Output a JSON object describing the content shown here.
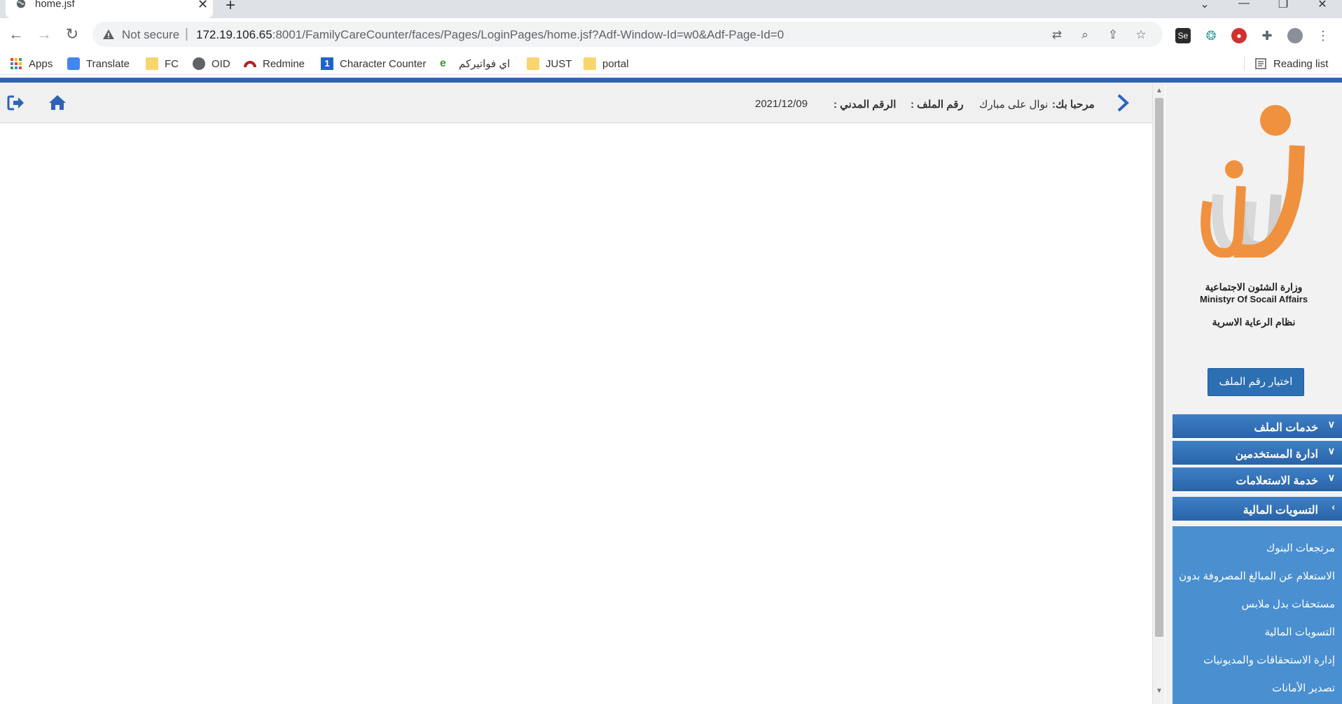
{
  "browser": {
    "tab_title": "home.jsf",
    "security_label": "Not secure",
    "url_host": "172.19.106.65",
    "url_path": ":8001/FamilyCareCounter/faces/Pages/LoginPages/home.jsf?Adf-Window-Id=w0&Adf-Page-Id=0",
    "ext_selenium_label": "Se",
    "bookmarks": {
      "apps": "Apps",
      "translate": "Translate",
      "fc": "FC",
      "oid": "OID",
      "redmine": "Redmine",
      "character_counter": "Character Counter",
      "fawatirkom": "اي فواتيركم",
      "just": "JUST",
      "portal": "portal",
      "reading_list": "Reading list"
    }
  },
  "header": {
    "welcome_label": "مرحبا بك:",
    "user_name": "نوال على مبارك",
    "file_number_label": "رقم الملف :",
    "civil_id_label": "الرقم المدني :",
    "date": "2021/12/09"
  },
  "sidebar": {
    "ministry_ar": "وزارة الشئون الاجتماعية",
    "ministry_en": "Ministyr Of Socail Affairs",
    "system_name": "نظام الرعاية الاسرية",
    "select_file_button": "اختيار رقم الملف",
    "menu": {
      "file_services": "خدمات الملف",
      "user_management": "ادارة المستخدمين",
      "inquiry_service": "خدمة الاستعلامات",
      "financial_settlements": "التسويات المالية"
    },
    "submenu": {
      "bank_returns": "مرتجعات البنوك",
      "spent_amounts_inquiry": "الاستعلام عن المبالغ المصروفة بدون",
      "clothing_allowance": "مستحقات بدل ملابس",
      "financial_settlements": "التسويات المالية",
      "dues_debts_management": "إدارة الاستحقاقات والمديونيات",
      "export_deposits": "تصدير الأمانات"
    }
  },
  "colors": {
    "accent_blue": "#2e63b8",
    "menu_blue": "#2e6db5",
    "logo_orange": "#f0913f"
  }
}
